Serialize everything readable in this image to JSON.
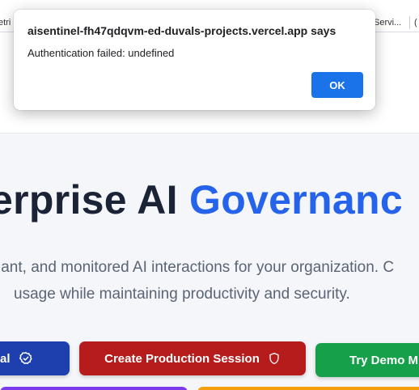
{
  "browser": {
    "bookmarks_left": "etri",
    "bookmarks_right": "Servi...",
    "bookmarks_folder": "("
  },
  "dialog": {
    "title": "aisentinel-fh47qdqvm-ed-duvals-projects.vercel.app says",
    "message": "Authentication failed: undefined",
    "ok_label": "OK"
  },
  "hero": {
    "title_start": "erprise AI ",
    "title_accent": "Governanc",
    "subtitle_line1": "iant, and monitored AI interactions for your organization. C",
    "subtitle_line2": "usage while maintaining productivity and security."
  },
  "actions": {
    "blue_label": "al",
    "red_label": "Create Production Session",
    "green_label": "Try Demo M"
  },
  "colors": {
    "accent": "#2563eb",
    "blue_button": "#1e3fae",
    "red_button": "#b71c1c",
    "green_button": "#17a04a",
    "purple_button": "#7c3aed",
    "orange_button": "#f59e0b",
    "dialog_ok": "#1a73e8"
  },
  "icons": {
    "blue_button": "check-badge-icon",
    "red_button": "shield-icon"
  }
}
